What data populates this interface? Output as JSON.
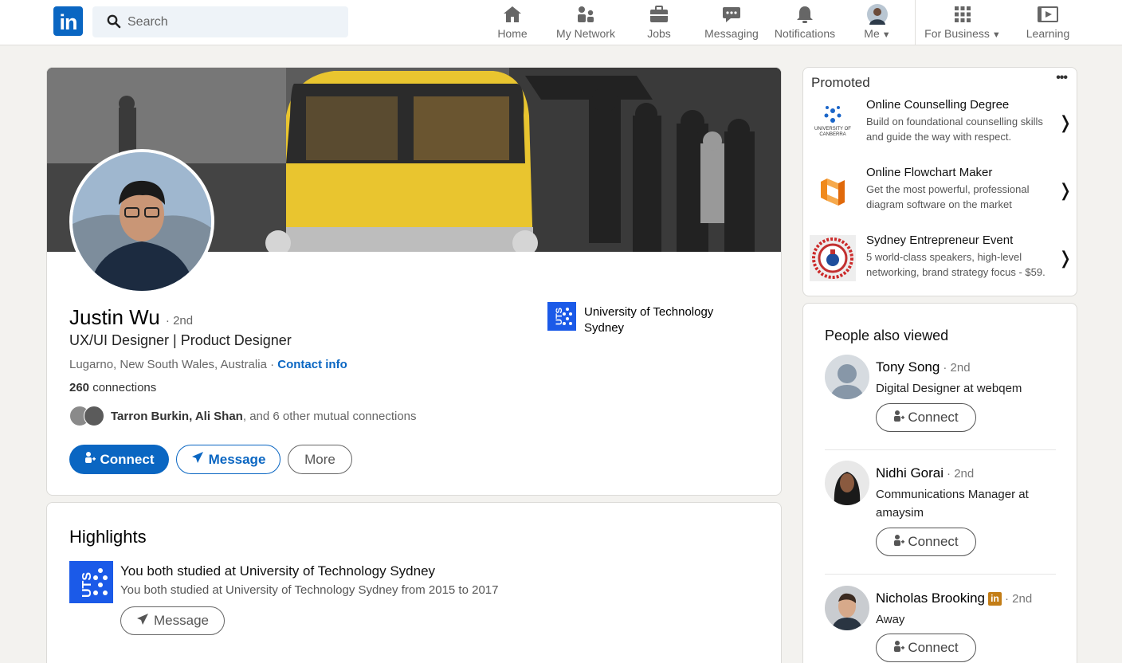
{
  "nav": {
    "logo_text": "in",
    "search_placeholder": "Search",
    "items": [
      {
        "label": "Home",
        "icon": "home-icon"
      },
      {
        "label": "My Network",
        "icon": "network-icon"
      },
      {
        "label": "Jobs",
        "icon": "briefcase-icon"
      },
      {
        "label": "Messaging",
        "icon": "messaging-icon"
      },
      {
        "label": "Notifications",
        "icon": "bell-icon"
      },
      {
        "label": "Me",
        "icon": "avatar"
      },
      {
        "label": "For Business",
        "icon": "grid-icon"
      },
      {
        "label": "Learning",
        "icon": "play-icon"
      }
    ]
  },
  "profile": {
    "name": "Justin Wu",
    "degree": "· 2nd",
    "headline": "UX/UI Designer | Product Designer",
    "location": "Lugarno, New South Wales, Australia ·",
    "contact_info": "Contact info",
    "connections_count": "260",
    "connections_label": "connections",
    "mutual_names": "Tarron Burkin, Ali Shan",
    "mutual_rest": ", and 6 other mutual connections",
    "school": "University of Technology Sydney",
    "school_logo_text": "UTS",
    "buttons": {
      "connect": "Connect",
      "message": "Message",
      "more": "More"
    }
  },
  "highlights": {
    "title": "Highlights",
    "item_title": "You both studied at University of Technology Sydney",
    "item_sub": "You both studied at University of Technology Sydney from 2015 to 2017",
    "message_button": "Message"
  },
  "promoted": {
    "label": "Promoted",
    "menu": "•••",
    "ads": [
      {
        "title": "Online Counselling Degree",
        "desc": "Build on foundational counselling skills and guide the way with respect.",
        "logo_text": "UNIVERSITY OF CANBERRA"
      },
      {
        "title": "Online Flowchart Maker",
        "desc": "Get the most powerful, professional diagram software on the market"
      },
      {
        "title": "Sydney Entrepreneur Event",
        "desc": "5 world-class speakers, high-level networking, brand strategy focus - $59."
      }
    ]
  },
  "people_also_viewed": {
    "title": "People also viewed",
    "people": [
      {
        "name": "Tony Song",
        "degree": "· 2nd",
        "title": "Digital Designer at webqem",
        "button": "Connect"
      },
      {
        "name": "Nidhi Gorai",
        "degree": "· 2nd",
        "title": "Communications Manager at amaysim",
        "button": "Connect"
      },
      {
        "name": "Nicholas Brooking",
        "degree": "· 2nd",
        "title": "Away",
        "button": "Connect",
        "badge": "in"
      }
    ]
  },
  "colors": {
    "brand": "#0a66c2",
    "uts": "#1b5ae8",
    "background": "#f3f2ef"
  }
}
